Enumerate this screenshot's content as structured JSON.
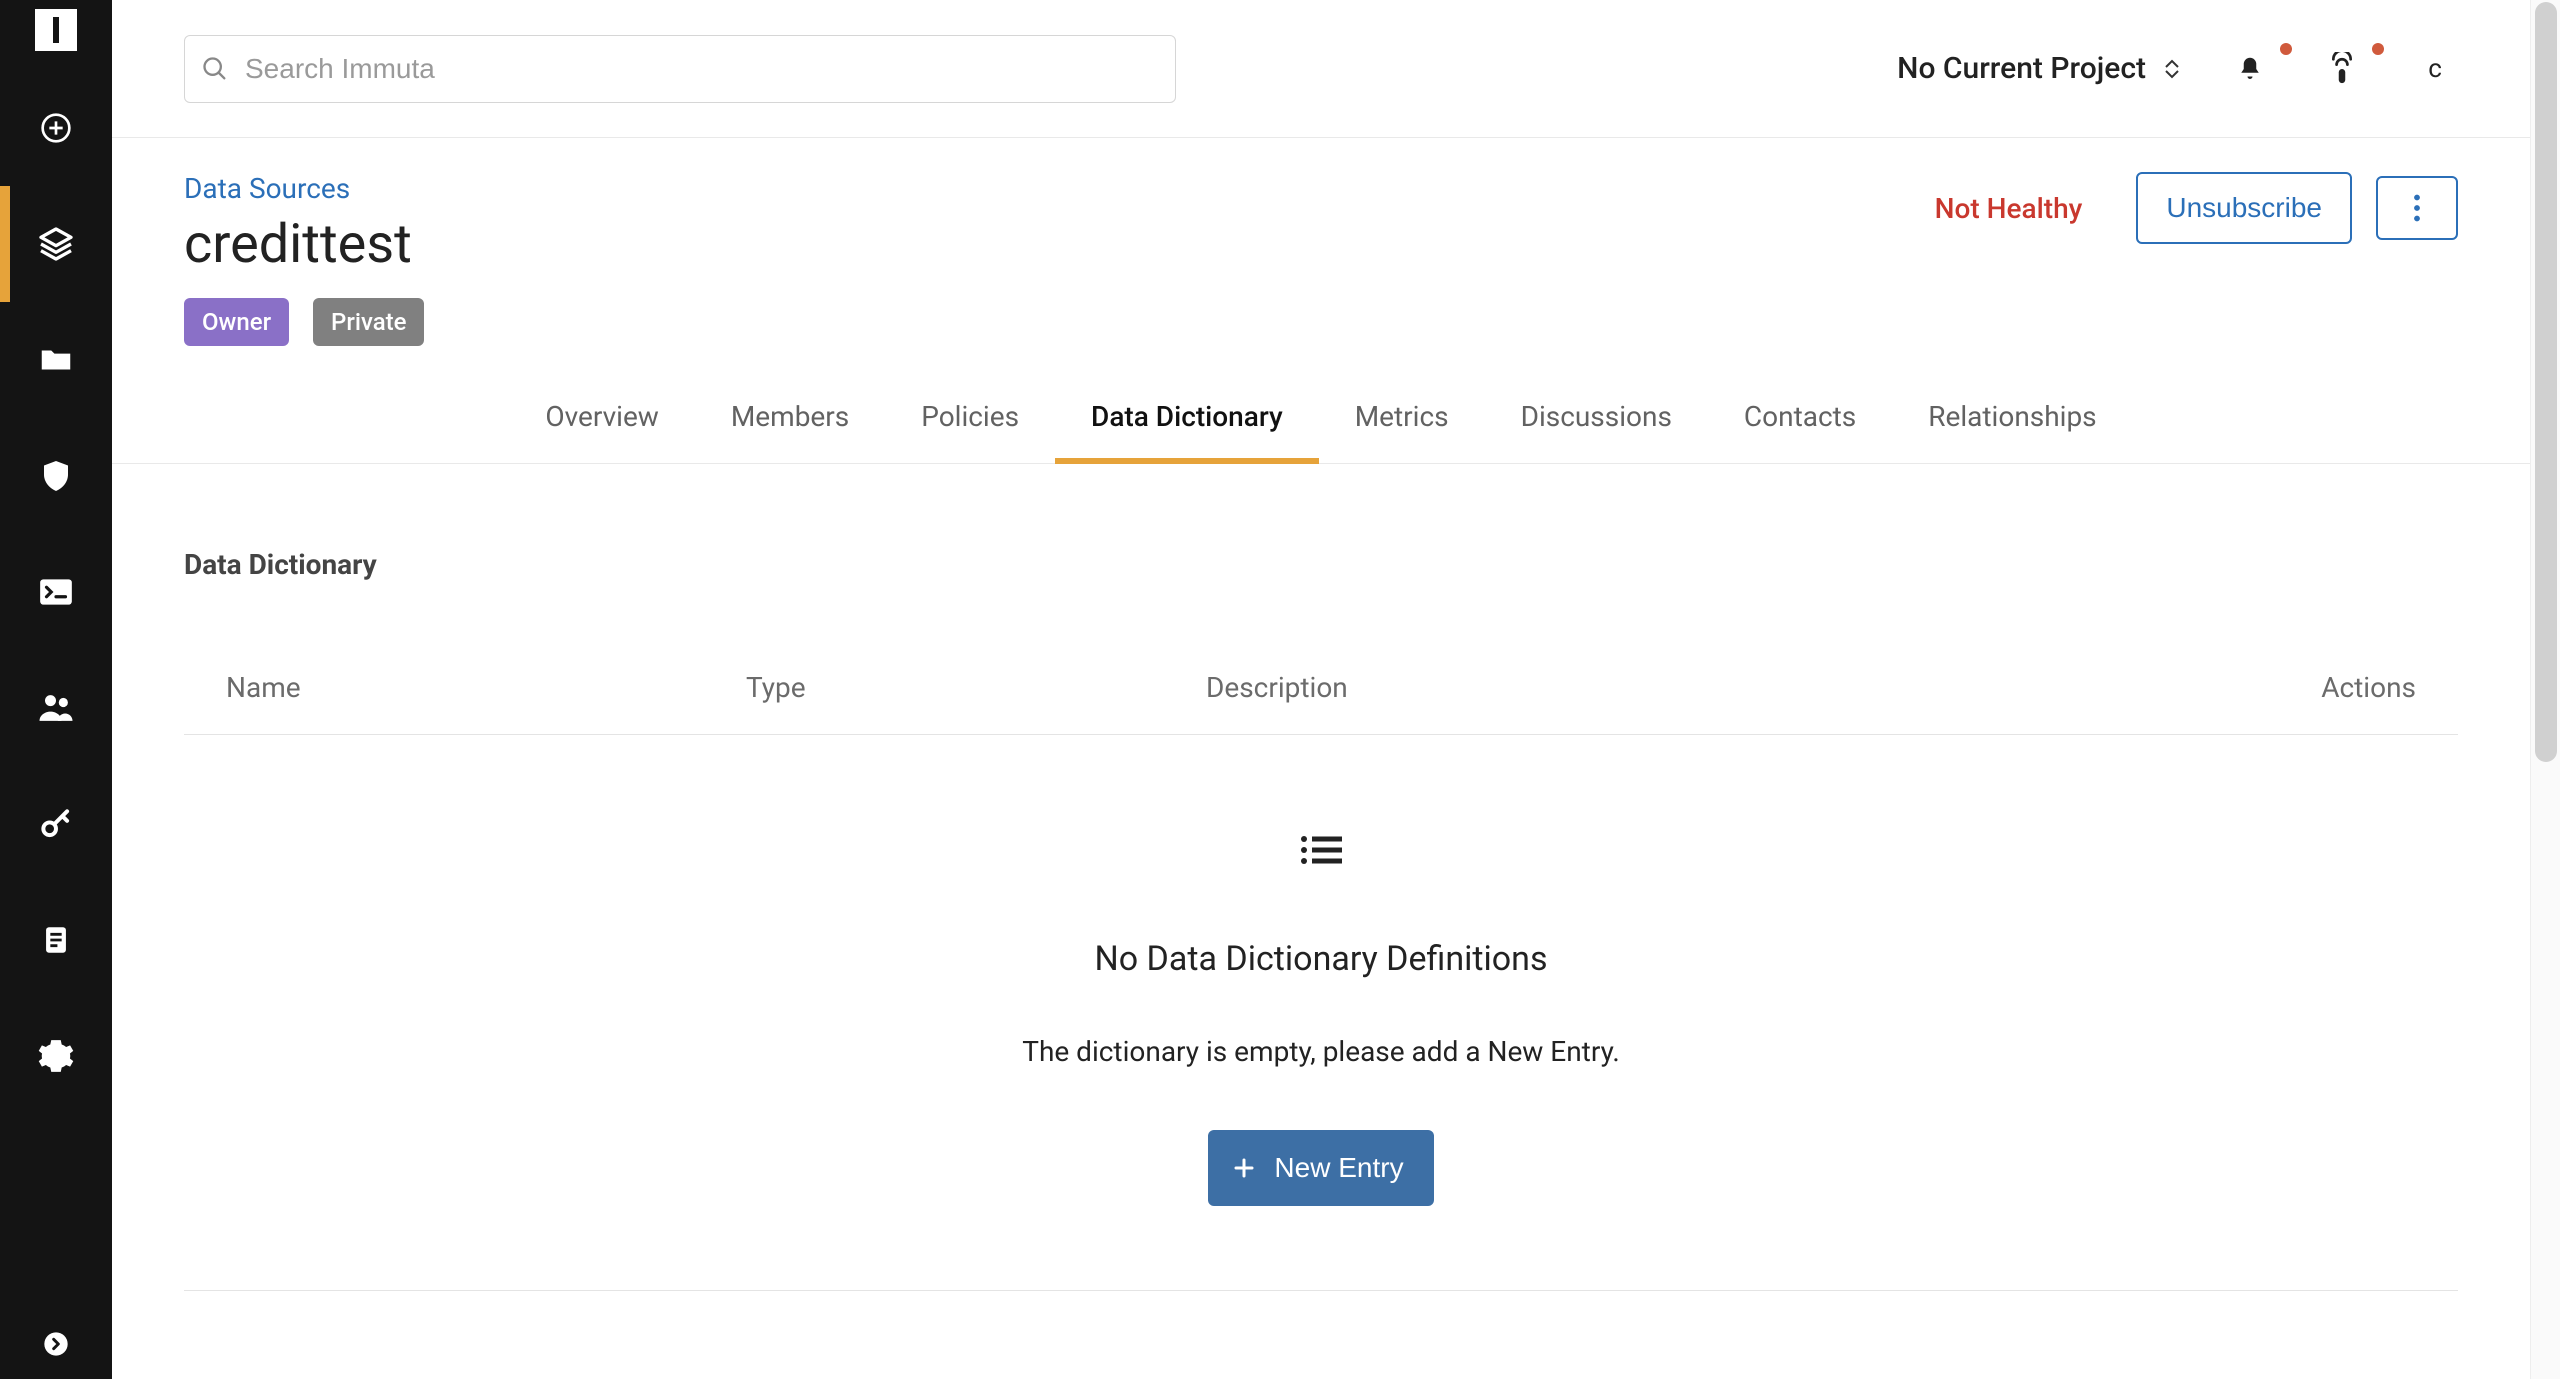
{
  "search": {
    "placeholder": "Search Immuta"
  },
  "project_selector": {
    "label": "No Current Project"
  },
  "avatar": {
    "initial": "c"
  },
  "sidebar": {
    "logo": "immuta-logo",
    "items": [
      {
        "name": "add",
        "icon": "plus-circle-icon"
      },
      {
        "name": "data",
        "icon": "layers-icon",
        "active": true
      },
      {
        "name": "projects",
        "icon": "folder-icon"
      },
      {
        "name": "policies",
        "icon": "shield-icon"
      },
      {
        "name": "console",
        "icon": "terminal-icon"
      },
      {
        "name": "users",
        "icon": "users-icon"
      },
      {
        "name": "keys",
        "icon": "key-icon"
      },
      {
        "name": "reports",
        "icon": "note-icon"
      },
      {
        "name": "settings",
        "icon": "gear-icon"
      }
    ],
    "bottom": {
      "name": "collapse",
      "icon": "arrow-right-circle-icon"
    }
  },
  "page": {
    "breadcrumb": "Data Sources",
    "title": "credittest",
    "chips": [
      {
        "label": "Owner",
        "kind": "owner"
      },
      {
        "label": "Private",
        "kind": "private"
      }
    ],
    "status": "Not Healthy",
    "actions": {
      "unsubscribe": "Unsubscribe"
    }
  },
  "tabs": [
    {
      "label": "Overview"
    },
    {
      "label": "Members"
    },
    {
      "label": "Policies"
    },
    {
      "label": "Data Dictionary",
      "active": true
    },
    {
      "label": "Metrics"
    },
    {
      "label": "Discussions"
    },
    {
      "label": "Contacts"
    },
    {
      "label": "Relationships"
    }
  ],
  "section": {
    "title": "Data Dictionary",
    "columns": {
      "name": "Name",
      "type": "Type",
      "description": "Description",
      "actions": "Actions"
    },
    "empty": {
      "heading": "No Data Dictionary Definitions",
      "body": "The dictionary is empty, please add a New Entry.",
      "button": "New Entry"
    }
  },
  "colors": {
    "accent": "#e6a33a",
    "link": "#2b6fb8",
    "danger": "#c9382e",
    "primary": "#3d6fa5"
  }
}
